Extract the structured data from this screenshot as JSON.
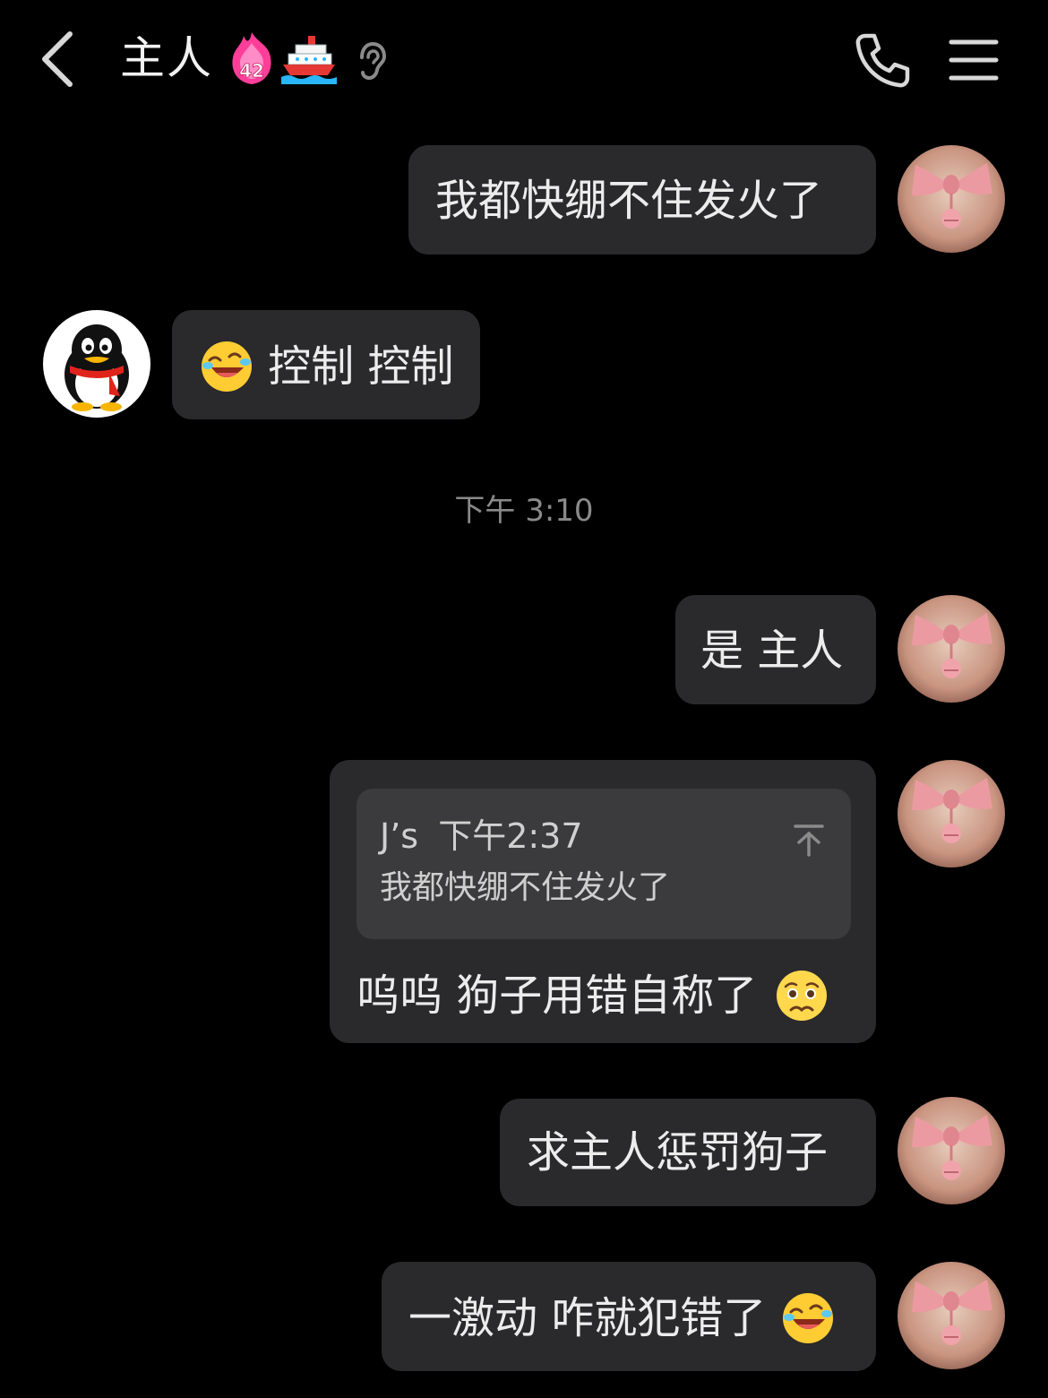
{
  "header": {
    "title": "主人",
    "fire_badge_level": "42"
  },
  "messages": [
    {
      "side": "right",
      "text": "我都快绷不住发火了"
    },
    {
      "side": "left",
      "text": "控制 控制",
      "emoji": "laughing-crying-emoji"
    },
    {
      "side": "right",
      "text": "是 主人"
    },
    {
      "side": "right",
      "quote": {
        "sender": "J’s",
        "time": "下午2:37",
        "text": "我都快绷不住发火了"
      },
      "text": "呜呜 狗子用错自称了",
      "emoji": "pleading-emoji"
    },
    {
      "side": "right",
      "text": "求主人惩罚狗子"
    },
    {
      "side": "right",
      "text": "一激动 咋就犯错了",
      "emoji": "laughing-crying-emoji"
    }
  ],
  "timestamp": "下午 3:10",
  "colors": {
    "background": "#000000",
    "bubble": "#2a2a2c",
    "quote_box": "#3b3b3d",
    "text": "#ececec",
    "timestamp": "#8a8a8a"
  }
}
